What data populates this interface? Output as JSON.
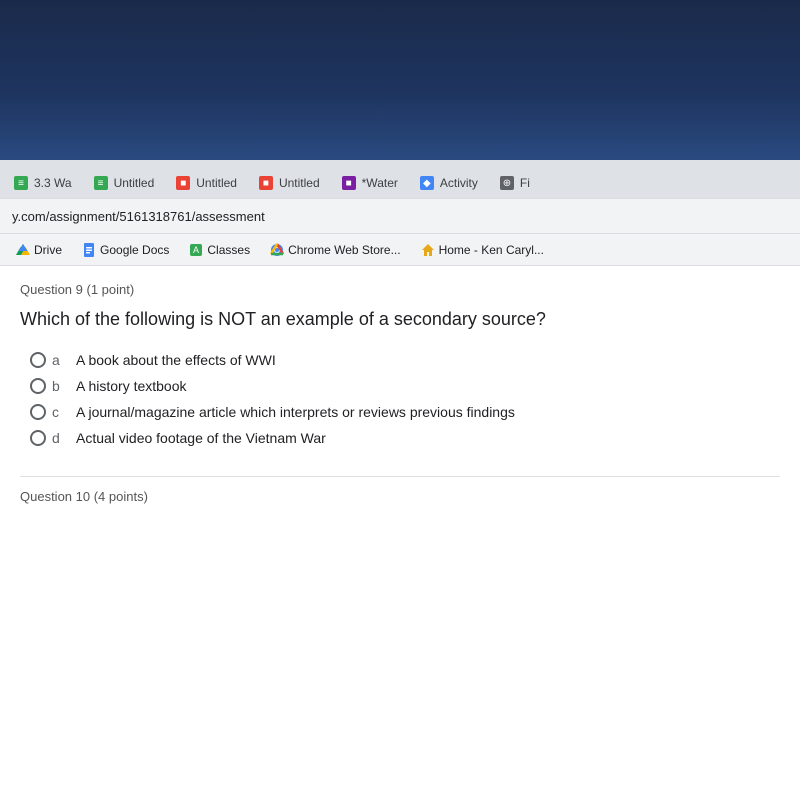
{
  "topBezel": {
    "label": "Top bezel"
  },
  "tabs": [
    {
      "id": "tab-33",
      "label": "3.3 Wa",
      "iconType": "text",
      "iconChar": "≡",
      "active": false
    },
    {
      "id": "tab-untitled1",
      "label": "Untitled",
      "iconType": "green",
      "iconChar": "≡",
      "active": false
    },
    {
      "id": "tab-untitled2",
      "label": "Untitled",
      "iconType": "red",
      "iconChar": "■",
      "active": false
    },
    {
      "id": "tab-untitled3",
      "label": "Untitled",
      "iconType": "red2",
      "iconChar": "■",
      "active": false
    },
    {
      "id": "tab-water",
      "label": "*Water",
      "iconType": "purple",
      "iconChar": "■",
      "active": false
    },
    {
      "id": "tab-activity",
      "label": "Activity",
      "iconType": "blue",
      "iconChar": "◆",
      "active": false
    },
    {
      "id": "tab-fi",
      "label": "Fi",
      "iconType": "globe",
      "iconChar": "⊕",
      "active": false
    }
  ],
  "addressBar": {
    "url": "y.com/assignment/5161318761/assessment"
  },
  "bookmarks": [
    {
      "id": "bm-drive",
      "label": "Drive",
      "icon": "drive"
    },
    {
      "id": "bm-googledocs",
      "label": "Google Docs",
      "icon": "gdocs"
    },
    {
      "id": "bm-classes",
      "label": "Classes",
      "icon": "classes"
    },
    {
      "id": "bm-chromewebstore",
      "label": "Chrome Web Store...",
      "icon": "chrome"
    },
    {
      "id": "bm-home",
      "label": "Home - Ken Caryl...",
      "icon": "home"
    }
  ],
  "question": {
    "number": "Question 9",
    "points": "(1 point)",
    "text": "Which of the following is NOT an example of a secondary source?",
    "options": [
      {
        "id": "opt-a",
        "letter": "a",
        "text": "A book about the effects of WWI"
      },
      {
        "id": "opt-b",
        "letter": "b",
        "text": "A history textbook"
      },
      {
        "id": "opt-c",
        "letter": "c",
        "text": "A journal/magazine article which interprets or reviews previous findings"
      },
      {
        "id": "opt-d",
        "letter": "d",
        "text": "Actual video footage of the Vietnam War"
      }
    ]
  },
  "question10Preview": {
    "text": "Question 10 (4 points)"
  }
}
